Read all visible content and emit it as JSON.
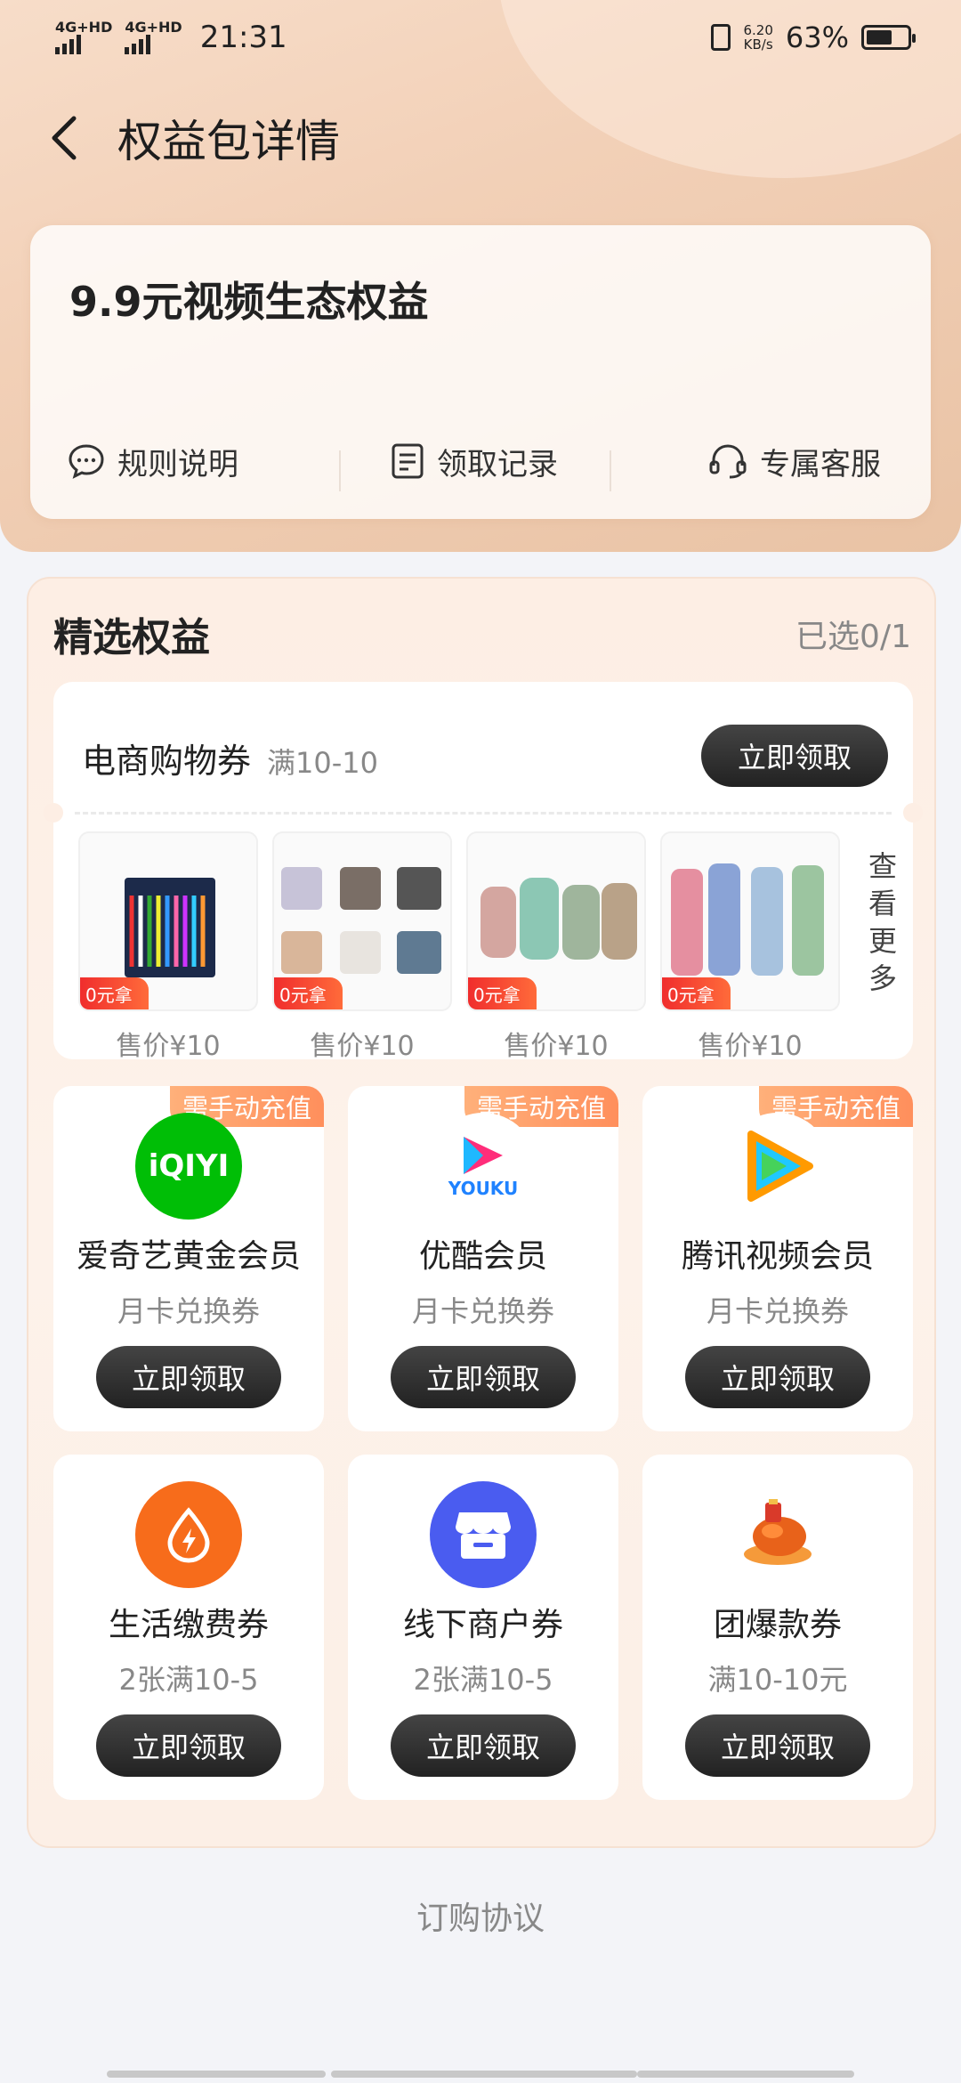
{
  "status_bar": {
    "network1": "4G+HD",
    "network2": "4G+HD",
    "time": "21:31",
    "speed_value": "6.20",
    "speed_unit": "KB/s",
    "battery": "63%",
    "battery_level": 0.63
  },
  "nav": {
    "title": "权益包详情"
  },
  "package": {
    "title": "9.9元视频生态权益",
    "actions": [
      {
        "label": "规则说明",
        "icon": "chat-bubble-icon"
      },
      {
        "label": "领取记录",
        "icon": "document-icon"
      },
      {
        "label": "专属客服",
        "icon": "headset-icon"
      }
    ]
  },
  "section": {
    "title": "精选权益",
    "selected_count": "已选0/1"
  },
  "shop": {
    "name": "电商购物券",
    "condition": "满10-10",
    "button": "立即领取",
    "more": "查看更多",
    "products": [
      {
        "tag": "0元拿",
        "price": "售价¥10",
        "icon": "toothbrush-set-image"
      },
      {
        "tag": "0元拿",
        "price": "售价¥10",
        "icon": "mug-set-image"
      },
      {
        "tag": "0元拿",
        "price": "售价¥10",
        "icon": "thermos-bottles-image"
      },
      {
        "tag": "0元拿",
        "price": "售价¥10",
        "icon": "rubber-gloves-image"
      }
    ]
  },
  "benefits": [
    {
      "badge": "需手动充值",
      "name": "爱奇艺黄金会员",
      "sub": "月卡兑换券",
      "button": "立即领取",
      "icon": "iqiyi-logo-icon",
      "logo_text": "iQIYI",
      "color": "#00be06"
    },
    {
      "badge": "需手动充值",
      "name": "优酷会员",
      "sub": "月卡兑换券",
      "button": "立即领取",
      "icon": "youku-logo-icon",
      "logo_text": "YOUKU",
      "color": "#1f82ff"
    },
    {
      "badge": "需手动充值",
      "name": "腾讯视频会员",
      "sub": "月卡兑换券",
      "button": "立即领取",
      "icon": "tencent-video-logo-icon",
      "color": "#ff8a00"
    },
    {
      "badge": "",
      "name": "生活缴费券",
      "sub": "2张满10-5",
      "button": "立即领取",
      "icon": "bill-payment-icon",
      "color": "#f76c1b"
    },
    {
      "badge": "",
      "name": "线下商户券",
      "sub": "2张满10-5",
      "button": "立即领取",
      "icon": "store-icon",
      "color": "#4a5cf0"
    },
    {
      "badge": "",
      "name": "团爆款券",
      "sub": "满10-10元",
      "button": "立即领取",
      "icon": "roast-chicken-icon",
      "color": "#f0642a"
    }
  ],
  "footer": {
    "agreement": "订购协议"
  }
}
